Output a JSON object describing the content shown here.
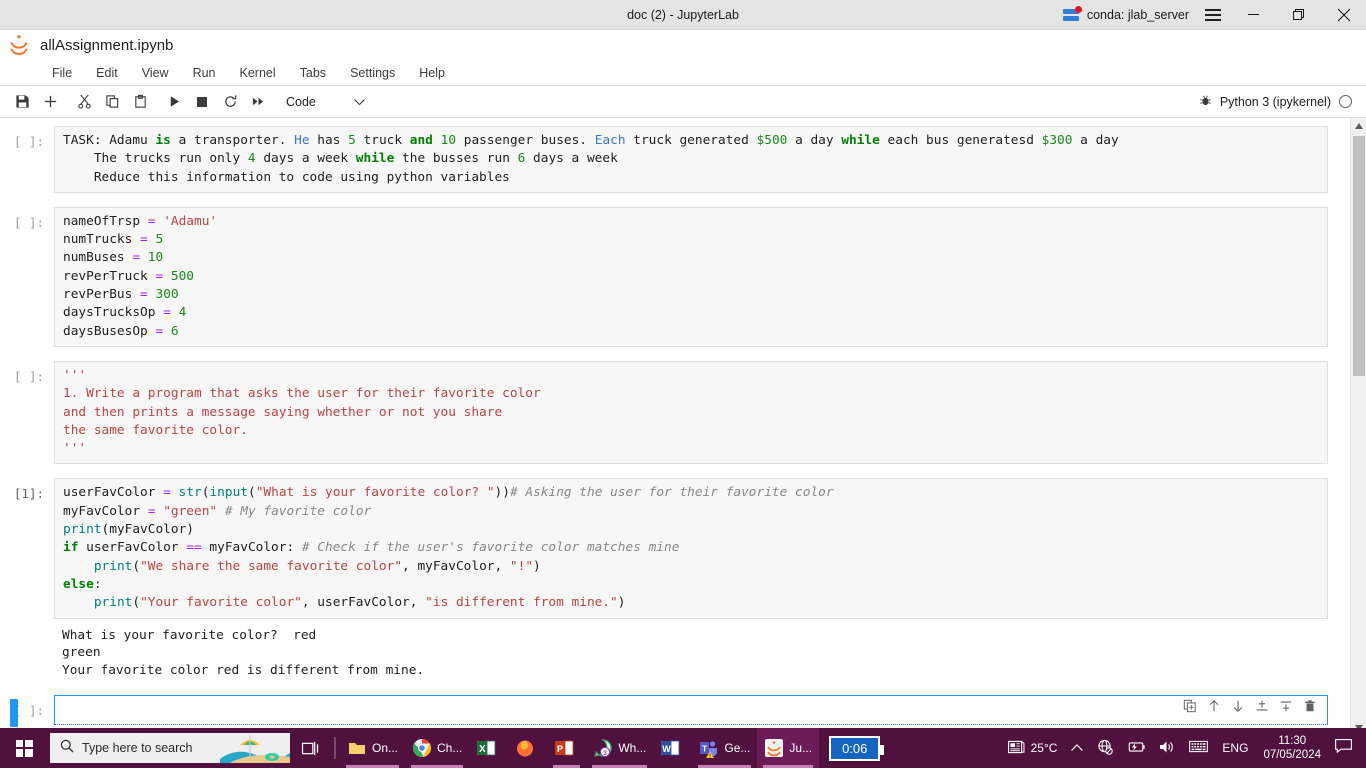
{
  "window": {
    "title": "doc (2) - JupyterLab",
    "conda_label": "conda: jlab_server",
    "minimize": "—",
    "maximize": "❐",
    "close": "✕"
  },
  "jupyter": {
    "document_title": "allAssignment.ipynb",
    "menu": [
      "File",
      "Edit",
      "View",
      "Run",
      "Kernel",
      "Tabs",
      "Settings",
      "Help"
    ],
    "toolbar": {
      "buttons": [
        "save-icon",
        "add-icon",
        "cut-icon",
        "copy-icon",
        "paste-icon",
        "run-icon",
        "stop-icon",
        "restart-icon",
        "restart-run-all-icon"
      ],
      "cell_type": "Code",
      "cell_type_caret": "⌄",
      "kernel_name": "Python 3 (ipykernel)",
      "bug_icon": "bug-icon"
    },
    "cell_toolbar_icons": [
      "duplicate-icon",
      "move-up-icon",
      "move-down-icon",
      "insert-above-icon",
      "insert-below-icon",
      "delete-icon"
    ]
  },
  "cells": [
    {
      "prompt": "[ ]:",
      "executed": false,
      "selected": false,
      "lines": [
        [
          {
            "t": "TASK: Adamu ",
            "c": "pl"
          },
          {
            "t": "is",
            "c": "kw"
          },
          {
            "t": " a transporter. ",
            "c": "pl"
          },
          {
            "t": "He",
            "c": "blue"
          },
          {
            "t": " has ",
            "c": "pl"
          },
          {
            "t": "5",
            "c": "num"
          },
          {
            "t": " truck ",
            "c": "pl"
          },
          {
            "t": "and",
            "c": "kw"
          },
          {
            "t": " ",
            "c": "pl"
          },
          {
            "t": "10",
            "c": "num"
          },
          {
            "t": " passenger buses. ",
            "c": "pl"
          },
          {
            "t": "Each",
            "c": "blue"
          },
          {
            "t": " truck generated ",
            "c": "pl"
          },
          {
            "t": "$500",
            "c": "num"
          },
          {
            "t": " a day ",
            "c": "pl"
          },
          {
            "t": "while",
            "c": "kw"
          },
          {
            "t": " each bus generatesd ",
            "c": "pl"
          },
          {
            "t": "$300",
            "c": "num"
          },
          {
            "t": " a day",
            "c": "pl"
          }
        ],
        [
          {
            "t": "    The trucks run only ",
            "c": "pl"
          },
          {
            "t": "4",
            "c": "num"
          },
          {
            "t": " days a week ",
            "c": "pl"
          },
          {
            "t": "while",
            "c": "kw"
          },
          {
            "t": " the busses run ",
            "c": "pl"
          },
          {
            "t": "6",
            "c": "num"
          },
          {
            "t": " days a week",
            "c": "pl"
          }
        ],
        [
          {
            "t": "    Reduce this information to code using python variables",
            "c": "pl"
          }
        ]
      ],
      "output": null
    },
    {
      "prompt": "[ ]:",
      "executed": false,
      "selected": false,
      "lines": [
        [
          {
            "t": "nameOfTrsp ",
            "c": "pl"
          },
          {
            "t": "=",
            "c": "op"
          },
          {
            "t": " ",
            "c": "pl"
          },
          {
            "t": "'Adamu'",
            "c": "str"
          }
        ],
        [
          {
            "t": "numTrucks ",
            "c": "pl"
          },
          {
            "t": "=",
            "c": "op"
          },
          {
            "t": " ",
            "c": "pl"
          },
          {
            "t": "5",
            "c": "num"
          }
        ],
        [
          {
            "t": "numBuses ",
            "c": "pl"
          },
          {
            "t": "=",
            "c": "op"
          },
          {
            "t": " ",
            "c": "pl"
          },
          {
            "t": "10",
            "c": "num"
          }
        ],
        [
          {
            "t": "revPerTruck ",
            "c": "pl"
          },
          {
            "t": "=",
            "c": "op"
          },
          {
            "t": " ",
            "c": "pl"
          },
          {
            "t": "500",
            "c": "num"
          }
        ],
        [
          {
            "t": "revPerBus ",
            "c": "pl"
          },
          {
            "t": "=",
            "c": "op"
          },
          {
            "t": " ",
            "c": "pl"
          },
          {
            "t": "300",
            "c": "num"
          }
        ],
        [
          {
            "t": "daysTrucksOp ",
            "c": "pl"
          },
          {
            "t": "=",
            "c": "op"
          },
          {
            "t": " ",
            "c": "pl"
          },
          {
            "t": "4",
            "c": "num"
          }
        ],
        [
          {
            "t": "daysBusesOp ",
            "c": "pl"
          },
          {
            "t": "=",
            "c": "op"
          },
          {
            "t": " ",
            "c": "pl"
          },
          {
            "t": "6",
            "c": "num"
          }
        ]
      ],
      "output": null
    },
    {
      "prompt": "[ ]:",
      "executed": false,
      "selected": false,
      "lines": [
        [
          {
            "t": "'''",
            "c": "str"
          }
        ],
        [
          {
            "t": "1. Write a program that asks the user for their favorite color",
            "c": "str"
          }
        ],
        [
          {
            "t": "and then prints a message saying whether or not you share",
            "c": "str"
          }
        ],
        [
          {
            "t": "the same favorite color.",
            "c": "str"
          }
        ],
        [
          {
            "t": "'''",
            "c": "str"
          }
        ]
      ],
      "output": null
    },
    {
      "prompt": "[1]:",
      "executed": true,
      "selected": false,
      "lines": [
        [
          {
            "t": "userFavColor ",
            "c": "pl"
          },
          {
            "t": "=",
            "c": "op"
          },
          {
            "t": " ",
            "c": "pl"
          },
          {
            "t": "str",
            "c": "bi"
          },
          {
            "t": "(",
            "c": "pl"
          },
          {
            "t": "input",
            "c": "bi"
          },
          {
            "t": "(",
            "c": "pl"
          },
          {
            "t": "\"What is your favorite color? \"",
            "c": "str"
          },
          {
            "t": "))",
            "c": "pl"
          },
          {
            "t": "# Asking the user for their favorite color",
            "c": "cmt"
          }
        ],
        [
          {
            "t": "myFavColor ",
            "c": "pl"
          },
          {
            "t": "=",
            "c": "op"
          },
          {
            "t": " ",
            "c": "pl"
          },
          {
            "t": "\"green\"",
            "c": "str"
          },
          {
            "t": " ",
            "c": "pl"
          },
          {
            "t": "# My favorite color",
            "c": "cmt"
          }
        ],
        [
          {
            "t": "print",
            "c": "bi"
          },
          {
            "t": "(myFavColor)",
            "c": "pl"
          }
        ],
        [
          {
            "t": "if",
            "c": "kw"
          },
          {
            "t": " userFavColor ",
            "c": "pl"
          },
          {
            "t": "==",
            "c": "op"
          },
          {
            "t": " myFavColor: ",
            "c": "pl"
          },
          {
            "t": "# Check if the user's favorite color matches mine",
            "c": "cmt"
          }
        ],
        [
          {
            "t": "    ",
            "c": "pl"
          },
          {
            "t": "print",
            "c": "bi"
          },
          {
            "t": "(",
            "c": "pl"
          },
          {
            "t": "\"We share the same favorite color\"",
            "c": "str"
          },
          {
            "t": ", myFavColor, ",
            "c": "pl"
          },
          {
            "t": "\"!\"",
            "c": "str"
          },
          {
            "t": ")",
            "c": "pl"
          }
        ],
        [
          {
            "t": "else",
            "c": "kw"
          },
          {
            "t": ":",
            "c": "pl"
          }
        ],
        [
          {
            "t": "    ",
            "c": "pl"
          },
          {
            "t": "print",
            "c": "bi"
          },
          {
            "t": "(",
            "c": "pl"
          },
          {
            "t": "\"Your favorite color\"",
            "c": "str"
          },
          {
            "t": ", userFavColor, ",
            "c": "pl"
          },
          {
            "t": "\"is different from mine.\"",
            "c": "str"
          },
          {
            "t": ")",
            "c": "pl"
          }
        ]
      ],
      "output": "What is your favorite color?  red\ngreen\nYour favorite color red is different from mine."
    },
    {
      "prompt": "[ ]:",
      "executed": false,
      "selected": true,
      "lines": [
        [
          {
            "t": "",
            "c": "pl"
          }
        ]
      ],
      "output": null
    },
    {
      "prompt": "[ ]:",
      "executed": false,
      "selected": false,
      "lines": [
        [
          {
            "t": "'''",
            "c": "str"
          }
        ]
      ],
      "output": null
    }
  ],
  "taskbar": {
    "search_placeholder": "Type here to search",
    "items": [
      {
        "label": "On...",
        "icon": "onedrive-icon",
        "active": false,
        "running": true
      },
      {
        "label": "Ch...",
        "icon": "chrome-icon",
        "active": false,
        "running": true
      },
      {
        "label": "",
        "icon": "excel-icon",
        "active": false,
        "running": false
      },
      {
        "label": "",
        "icon": "firefox-icon",
        "active": false,
        "running": false
      },
      {
        "label": "",
        "icon": "powerpoint-icon",
        "active": false,
        "running": true
      },
      {
        "label": "Wh...",
        "icon": "whatsapp-icon",
        "badge": "3",
        "active": false,
        "running": true
      },
      {
        "label": "",
        "icon": "word-icon",
        "active": false,
        "running": false
      },
      {
        "label": "Ge...",
        "icon": "teams-icon",
        "active": false,
        "running": true
      },
      {
        "label": "Ju...",
        "icon": "jupyter-icon",
        "active": true,
        "running": true
      }
    ],
    "timer": "0:06",
    "tray": {
      "weather": "25°C",
      "language": "ENG",
      "time": "11:30",
      "date": "07/05/2024",
      "icons": [
        "news-weather-icon",
        "chevron-up-icon",
        "network-offline-icon",
        "battery-charging-icon",
        "volume-icon",
        "keyboard-icon",
        "notification-icon"
      ]
    }
  },
  "colors": {
    "accent_blue": "#2196f3",
    "taskbar_bg": "#50113f",
    "titlebar_bg": "#e4e4e4",
    "cell_bg": "#f7f7f7"
  }
}
